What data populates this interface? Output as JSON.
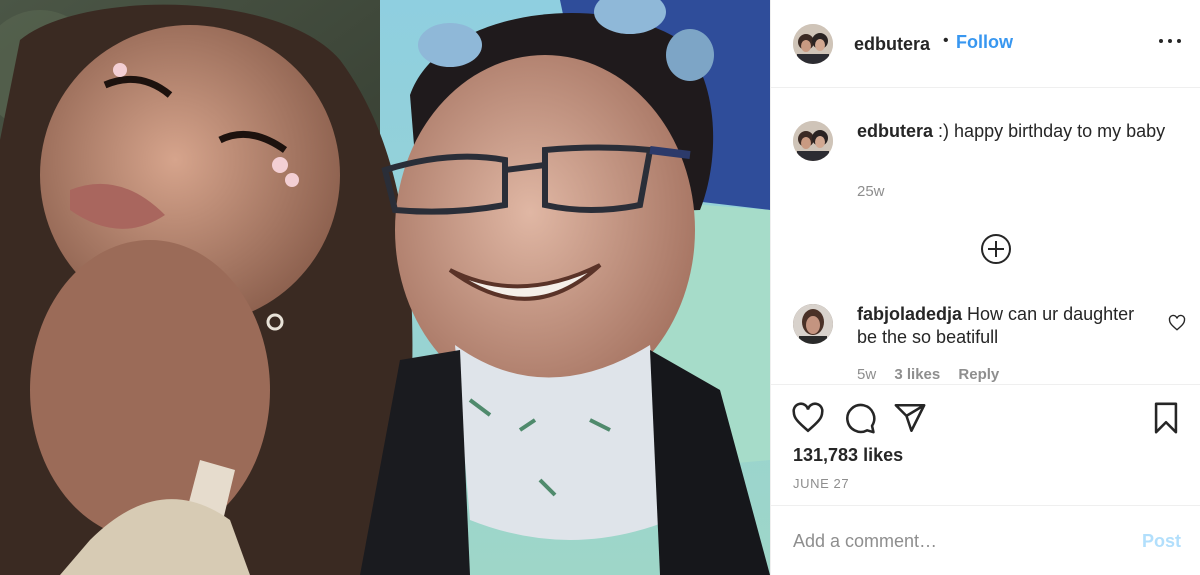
{
  "post": {
    "author": "edbutera",
    "separator": "•",
    "follow_label": "Follow",
    "caption_text": ":) happy birthday to my baby",
    "caption_time": "25w",
    "likes": "131,783 likes",
    "date": "JUNE 27",
    "add_comment_placeholder": "Add a comment…",
    "post_label": "Post",
    "accent_color": "#3897f0"
  },
  "comments": [
    {
      "username": "fabjoladedja",
      "text": "How can ur daughter be the so beatifull",
      "time": "5w",
      "likes": "3 likes",
      "reply_label": "Reply"
    }
  ],
  "icons": {
    "more": "more-options-icon",
    "load_more": "plus-circle-icon",
    "like": "heart-icon",
    "comment": "comment-icon",
    "share": "paper-plane-icon",
    "save": "bookmark-icon"
  }
}
